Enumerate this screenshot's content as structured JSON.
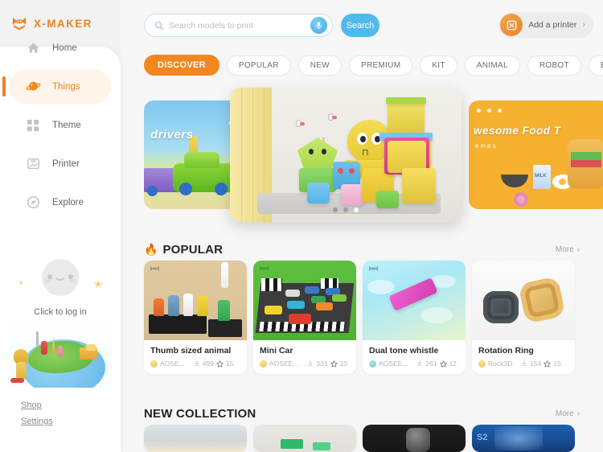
{
  "app": {
    "name": "X-MAKER",
    "logo_color": "#ef8022"
  },
  "sidebar": {
    "items": [
      {
        "label": "Home",
        "icon": "home-icon",
        "active": false
      },
      {
        "label": "Things",
        "icon": "planet-icon",
        "active": true
      },
      {
        "label": "Theme",
        "icon": "grid-icon",
        "active": false
      },
      {
        "label": "Printer",
        "icon": "printer-icon",
        "active": false
      },
      {
        "label": "Explore",
        "icon": "compass-icon",
        "active": false
      }
    ],
    "login": {
      "prompt": "Click to log in"
    },
    "links": [
      {
        "label": "Shop"
      },
      {
        "label": "Settings"
      }
    ]
  },
  "header": {
    "search": {
      "placeholder": "Search models to print",
      "value": "",
      "mic_icon": "microphone-icon",
      "search_icon": "search-icon"
    },
    "search_button": "Search",
    "printer_button": {
      "label": "Add a printer",
      "icon": "printer-add-icon",
      "chevron": "›",
      "accent": "#e8822a"
    }
  },
  "tabs": {
    "active_index": 0,
    "items": [
      {
        "label": "DISCOVER"
      },
      {
        "label": "POPULAR"
      },
      {
        "label": "NEW"
      },
      {
        "label": "PREMIUM"
      },
      {
        "label": "KIT"
      },
      {
        "label": "ANIMAL"
      },
      {
        "label": "ROBOT"
      },
      {
        "label": "BUILDING"
      }
    ]
  },
  "carousel": {
    "active_dot": 2,
    "dot_count": 3,
    "slides": [
      {
        "position": "left",
        "title": "drivers",
        "subtitle": ""
      },
      {
        "position": "center",
        "title": "",
        "subtitle": ""
      },
      {
        "position": "right",
        "title": "wesome Food T",
        "subtitle": "emes"
      }
    ]
  },
  "sections": [
    {
      "id": "popular",
      "title": "POPULAR",
      "icon": "flame-icon",
      "more_label": "More",
      "more_chevron": "›",
      "cards": [
        {
          "title": "Thumb sized animal",
          "author": "AOSE...",
          "downloads": "499",
          "likes": "15",
          "art": "a-thumb"
        },
        {
          "title": "Mini Car",
          "author": "AOSEE...",
          "downloads": "331",
          "likes": "10",
          "art": "a-car"
        },
        {
          "title": "Dual tone whistle",
          "author": "AOSEE...",
          "downloads": "261",
          "likes": "12",
          "art": "a-whistle"
        },
        {
          "title": "Rotation Ring",
          "author": "Rock3D",
          "downloads": "154",
          "likes": "15",
          "art": "a-ring"
        }
      ]
    },
    {
      "id": "new-collection",
      "title": "NEW COLLECTION",
      "icon": "",
      "more_label": "More",
      "more_chevron": "›",
      "cards": [
        {
          "title": "",
          "author": "",
          "downloads": "",
          "likes": "",
          "art": "nc1"
        },
        {
          "title": "",
          "author": "",
          "downloads": "",
          "likes": "",
          "art": "nc2"
        },
        {
          "title": "",
          "author": "",
          "downloads": "",
          "likes": "",
          "art": "nc3"
        },
        {
          "title": "",
          "author": "",
          "downloads": "",
          "likes": "",
          "art": "nc4"
        }
      ]
    }
  ],
  "colors": {
    "accent_orange": "#f4861f",
    "accent_blue": "#52b9ec",
    "sidebar_bg": "#ffffff",
    "page_bg": "#f6f6f6"
  }
}
